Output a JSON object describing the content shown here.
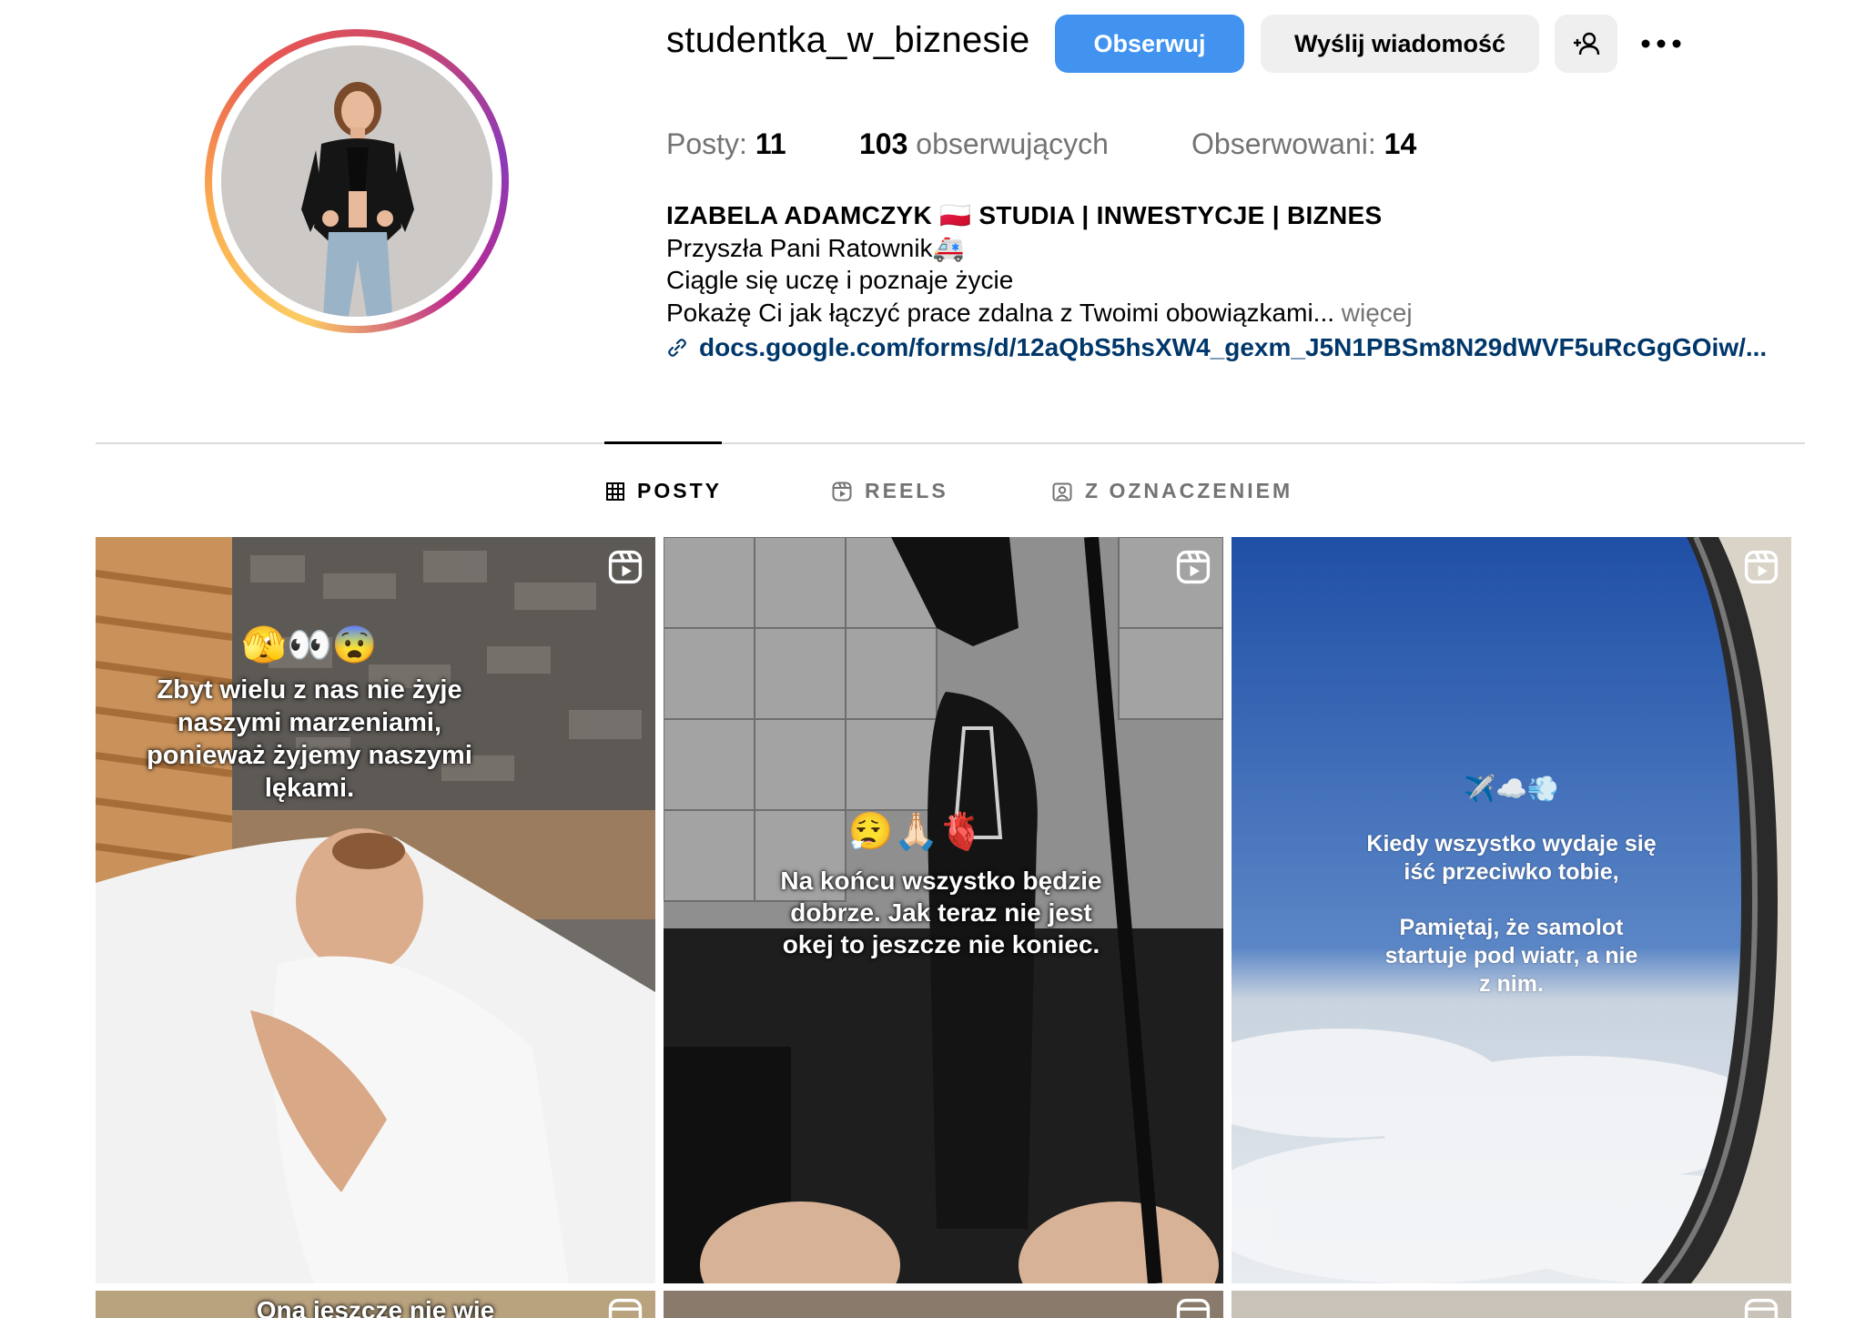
{
  "profile": {
    "username": "studentka_w_biznesie",
    "follow_label": "Obserwuj",
    "message_label": "Wyślij wiadomość",
    "more_icon": "more-horizontal-icon",
    "add_user_icon": "add-user-icon"
  },
  "stats": {
    "posts_label": "Posty:",
    "posts_count": "11",
    "followers_count": "103",
    "followers_label": "obserwujących",
    "following_label": "Obserwowani:",
    "following_count": "14"
  },
  "bio": {
    "name": "IZABELA ADAMCZYK 🇵🇱 STUDIA | INWESTYCJE | BIZNES",
    "line1": "Przyszła Pani Ratownik🚑",
    "line2": "Ciągle się uczę i poznaje życie",
    "line3": "Pokażę Ci jak łączyć prace zdalna z Twoimi obowiązkami...",
    "more": "więcej",
    "link": "docs.google.com/forms/d/12aQbS5hsXW4_gexm_J5N1PBSm8N29dWVF5uRcGgGOiw/..."
  },
  "tabs": {
    "posts": "POSTY",
    "reels": "REELS",
    "tagged": "Z OZNACZENIEM",
    "active": "posts"
  },
  "posts": [
    {
      "emoji": "🫣👀😨",
      "text1": "Zbyt wielu z nas nie żyje",
      "text2": "naszymi marzeniami,",
      "text3": "ponieważ żyjemy naszymi",
      "text4": "lękami."
    },
    {
      "emoji": "😮‍💨🙏🏻🫀",
      "text1": "Na końcu wszystko będzie",
      "text2": "dobrze. Jak teraz nie jest",
      "text3": "okej to jeszcze nie koniec."
    },
    {
      "emoji": "✈️☁️💨",
      "text1": "Kiedy wszystko wydaje się",
      "text2": "iść przeciwko tobie,",
      "text3": "Pamiętaj, że samolot",
      "text4": "startuje pod wiatr, a nie",
      "text5": "z nim."
    },
    {
      "text1": "Ona jeszcze nie wie"
    }
  ],
  "colors": {
    "accent_blue": "#4193ef",
    "link_blue": "#00376b",
    "muted": "#737373",
    "button_gray": "#efefef"
  }
}
